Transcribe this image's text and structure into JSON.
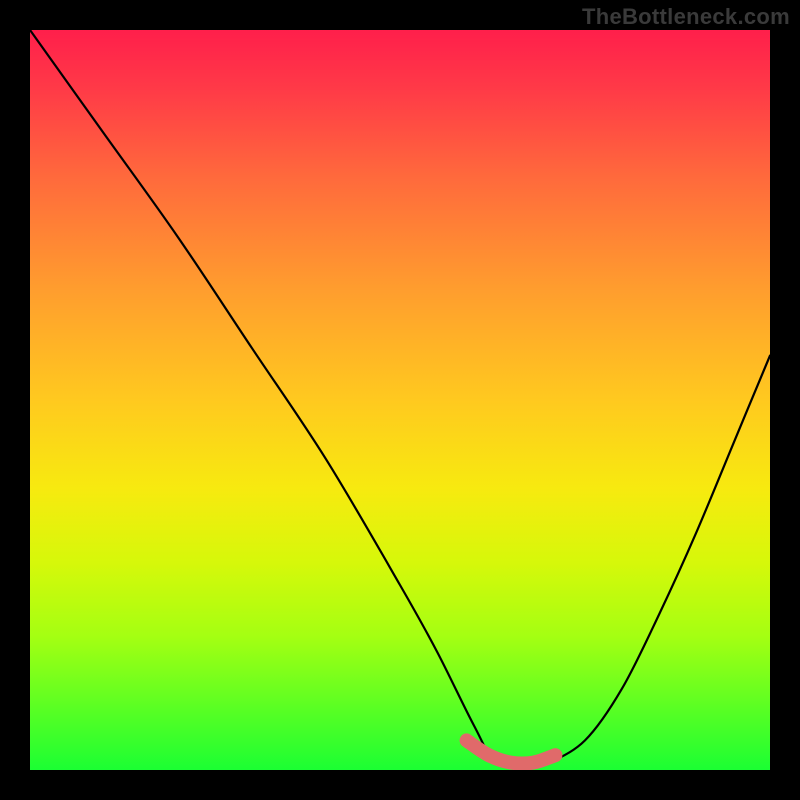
{
  "watermark": "TheBottleneck.com",
  "chart_data": {
    "type": "line",
    "title": "",
    "xlabel": "",
    "ylabel": "",
    "xlim": [
      0,
      100
    ],
    "ylim": [
      0,
      100
    ],
    "grid": false,
    "legend": false,
    "series": [
      {
        "name": "bottleneck-curve",
        "color": "#000000",
        "x": [
          0,
          10,
          20,
          30,
          40,
          50,
          55,
          60,
          63,
          67,
          70,
          75,
          80,
          85,
          90,
          95,
          100
        ],
        "values": [
          100,
          86,
          72,
          57,
          42,
          25,
          16,
          6,
          1,
          1,
          1,
          4,
          11,
          21,
          32,
          44,
          56
        ]
      },
      {
        "name": "highlight-band",
        "color": "#e06a6a",
        "thick": true,
        "x": [
          59,
          62,
          65,
          68,
          71
        ],
        "values": [
          4,
          2,
          1,
          1,
          2
        ]
      }
    ],
    "annotations": []
  }
}
